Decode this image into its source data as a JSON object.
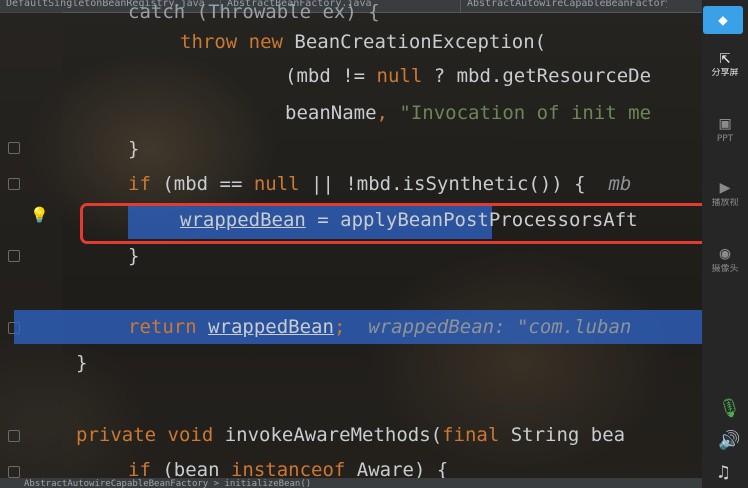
{
  "tabs": [
    {
      "label": "DefaultSingletonBeanRegistry.java"
    },
    {
      "label": "AbstractBeanFactory.java"
    },
    {
      "label": "AbstractAutowireCapableBeanFactory.java"
    }
  ],
  "code": {
    "l0": "catch (Throwable ex) {",
    "l1_kw1": "throw",
    "l1_kw2": "new",
    "l1_rest": " BeanCreationException(",
    "l2_a": "(mbd != ",
    "l2_null": "null",
    "l2_b": " ? mbd.getResourceDe",
    "l3_a": "beanName",
    "l3_comma": ", ",
    "l3_str": "\"Invocation of init me",
    "l4": "}",
    "l5_kw": "if",
    "l5_a": " (mbd == ",
    "l5_null": "null",
    "l5_b": " || !mbd.isSynthetic()) {  ",
    "l5_hint": "mb",
    "l6_var": "wrappedBean",
    "l6_rest": " = applyBeanPostProcessorsAft",
    "l7": "}",
    "l8_kw": "return",
    "l8_var": "wrappedBean",
    "l8_semi": ";  ",
    "l8_hint": "wrappedBean: \"com.luban",
    "l9": "}",
    "l10_kw1": "private",
    "l10_kw2": "void",
    "l10_a": " invokeAwareMethods(",
    "l10_kw3": "final",
    "l10_b": " String bea",
    "l11_kw": "if",
    "l11_a": " (bean ",
    "l11_kw2": "instanceof",
    "l11_b": " Aware) {"
  },
  "sidebar": {
    "share_label": "分享屏",
    "ppt_label": "PPT",
    "video_label": "播放视",
    "camera_label": "摄像头"
  },
  "status": {
    "breadcrumb": "AbstractAutowireCapableBeanFactory  >  initializeBean()"
  }
}
